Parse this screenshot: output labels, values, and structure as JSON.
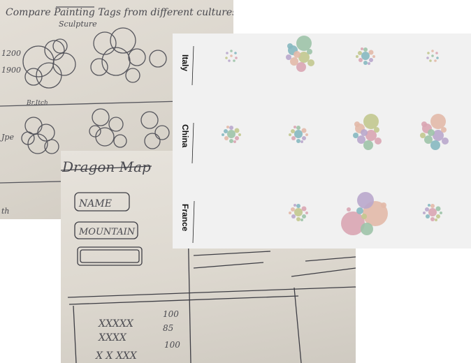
{
  "sketch_top": {
    "title": "Compare Painting Tags from different cultures",
    "subtitle": "Sculpture",
    "row_label_1": "1200",
    "row_label_2": "1900",
    "row_label_3": "Br.Itch",
    "row_label_4": "Jpe",
    "row_label_5": "th"
  },
  "sketch_bottom": {
    "title": "Dragon Map",
    "field_1": "NAME",
    "field_2": "MOUNTAIN",
    "list_rows": [
      {
        "text": "XXXXX",
        "value": "100"
      },
      {
        "text": "XXXX",
        "value": "85"
      },
      {
        "text": "X X XXX",
        "value": "100"
      }
    ]
  },
  "chart_data": {
    "type": "packed-bubble-grid",
    "rows": [
      "Italy",
      "China",
      "France"
    ],
    "columns": 4,
    "colors": {
      "pink": "#d9a5b3",
      "purple": "#b9a7cc",
      "green": "#9dc3a8",
      "teal": "#86b8c0",
      "olive": "#c2c88f",
      "peach": "#e2b9a8"
    },
    "cells": [
      {
        "row": "Italy",
        "col": 1,
        "size": "tiny"
      },
      {
        "row": "Italy",
        "col": 2,
        "size": "medium"
      },
      {
        "row": "Italy",
        "col": 3,
        "size": "small"
      },
      {
        "row": "Italy",
        "col": 4,
        "size": "tiny"
      },
      {
        "row": "China",
        "col": 1,
        "size": "small"
      },
      {
        "row": "China",
        "col": 2,
        "size": "small"
      },
      {
        "row": "China",
        "col": 3,
        "size": "medium"
      },
      {
        "row": "China",
        "col": 4,
        "size": "medium"
      },
      {
        "row": "France",
        "col": 1,
        "size": "empty"
      },
      {
        "row": "France",
        "col": 2,
        "size": "small"
      },
      {
        "row": "France",
        "col": 3,
        "size": "large"
      },
      {
        "row": "France",
        "col": 4,
        "size": "small"
      }
    ]
  }
}
